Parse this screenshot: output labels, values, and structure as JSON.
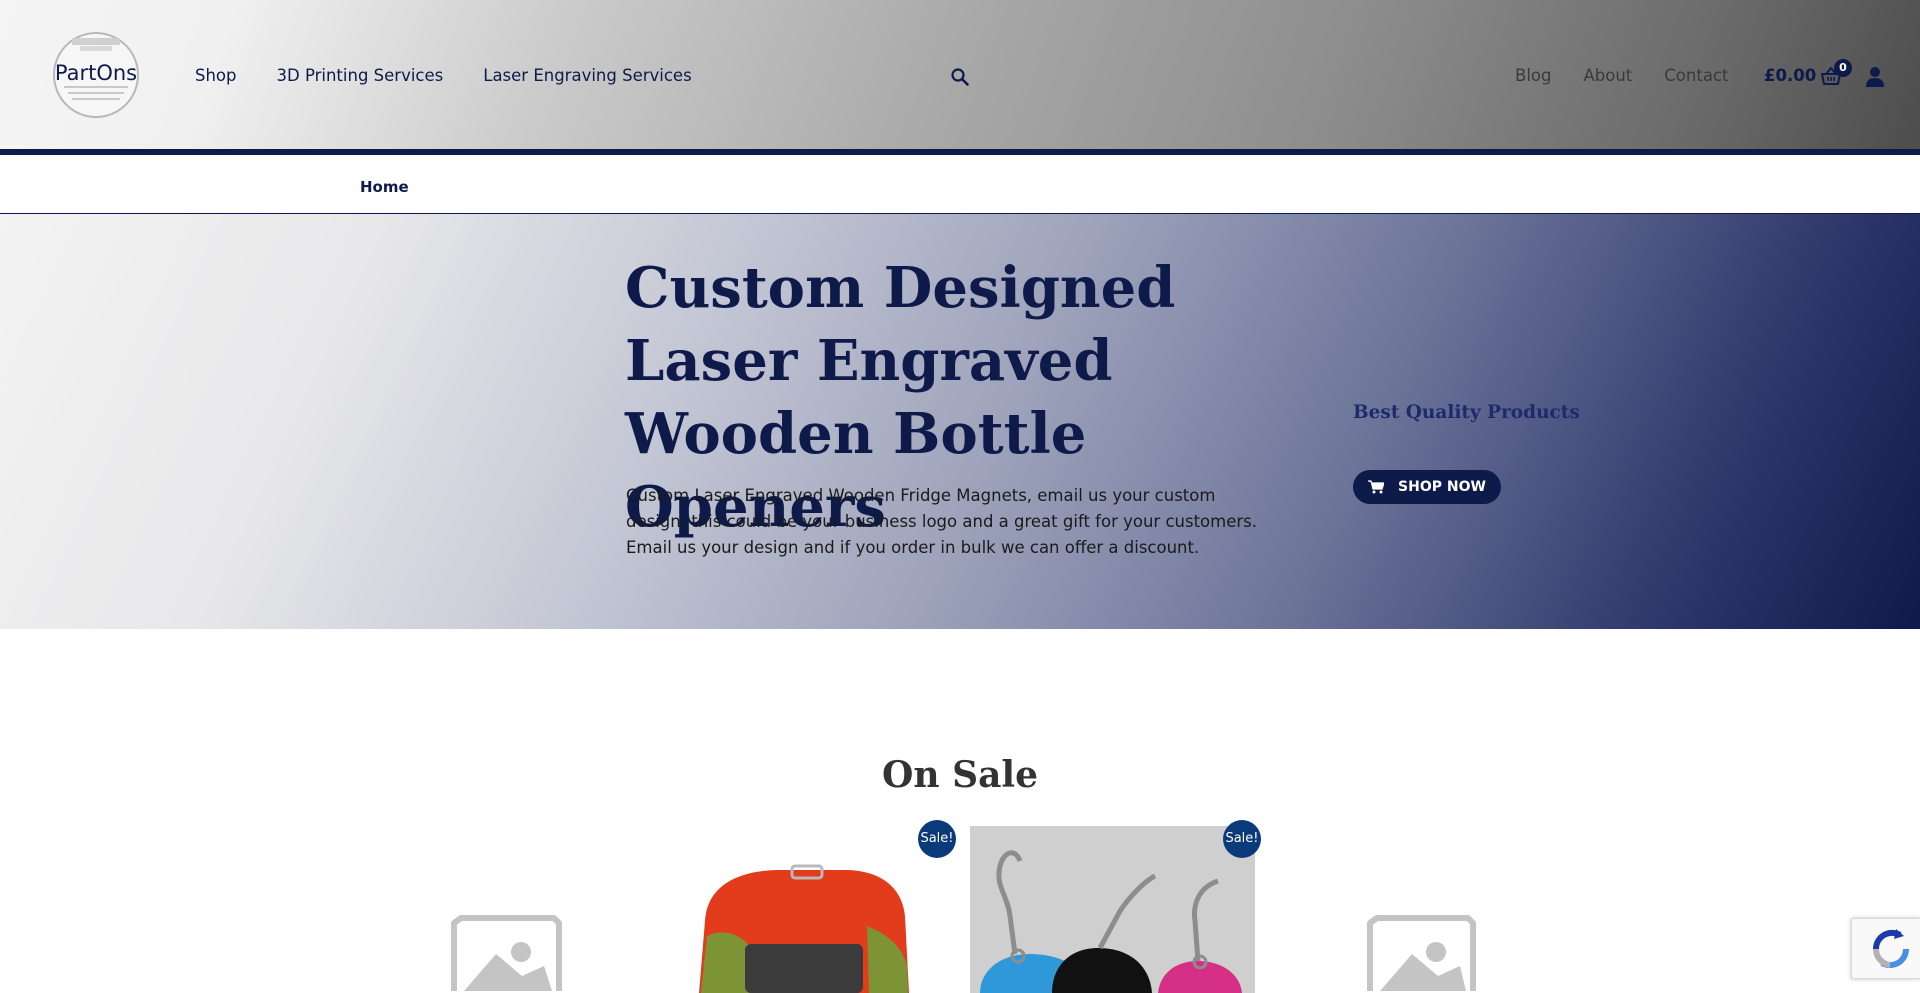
{
  "header": {
    "logo_text": "PartOns",
    "nav": [
      "Shop",
      "3D Printing Services",
      "Laser Engraving Services"
    ],
    "right_nav": [
      "Blog",
      "About",
      "Contact"
    ],
    "cart_total": "£0.00",
    "cart_count": "0"
  },
  "breadcrumb": {
    "home": "Home"
  },
  "hero": {
    "title": "Custom Designed Laser Engraved Wooden Bottle Openers",
    "description": "Custom Laser Engraved Wooden Fridge Magnets, email us your custom design, this could be your business logo and a great gift for your customers.  Email us your design and if you order in bulk we can offer a discount.",
    "side_title": "Best Quality Products",
    "button_label": "SHOP NOW"
  },
  "on_sale": {
    "title": "On Sale",
    "products": [
      {
        "image": "placeholder-image"
      },
      {
        "image": "red-silicone-watch-strap",
        "badge": "Sale!"
      },
      {
        "image": "colored-keychain-tags",
        "badge": "Sale!"
      },
      {
        "image": "placeholder-image"
      }
    ]
  },
  "colors": {
    "navy": "#0e1a4a",
    "badge_blue": "#0b3a7a"
  }
}
